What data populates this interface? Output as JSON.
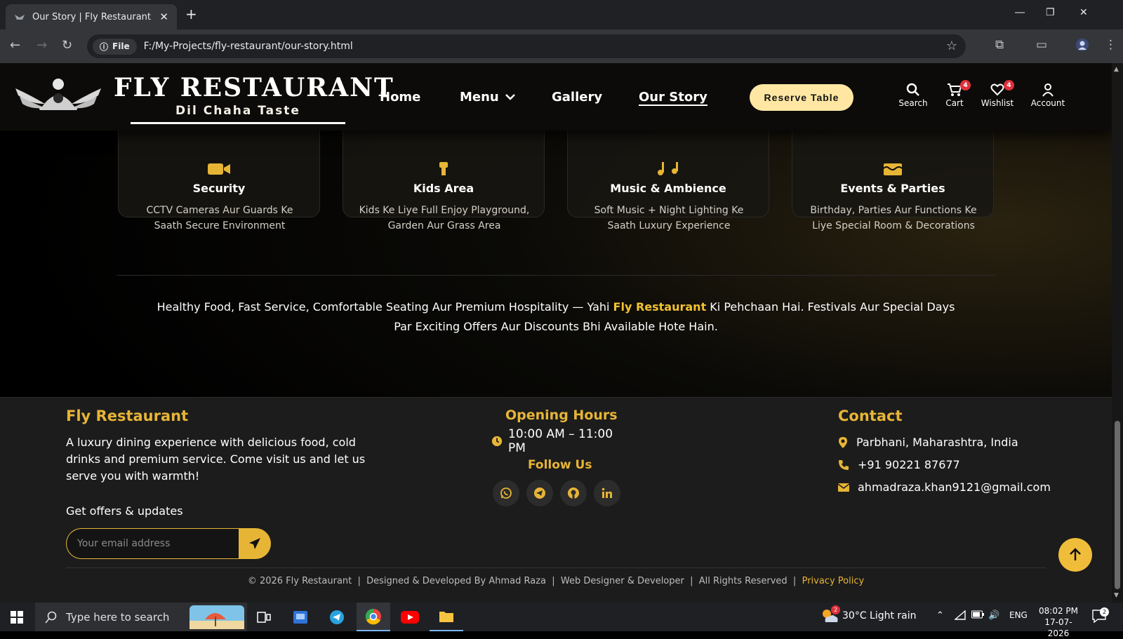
{
  "browser": {
    "tab_title": "Our Story | Fly Restaurant",
    "url_chip": "File",
    "url": "F:/My-Projects/fly-restaurant/our-story.html"
  },
  "header": {
    "brand": "FLY RESTAURANT",
    "tagline": "Dil Chaha Taste",
    "nav": {
      "home": "Home",
      "menu": "Menu",
      "gallery": "Gallery",
      "our_story": "Our Story"
    },
    "reserve": "Reserve Table",
    "actions": {
      "search": "Search",
      "cart": "Cart",
      "cart_count": "4",
      "wishlist": "Wishlist",
      "wishlist_count": "4",
      "account": "Account"
    }
  },
  "features": [
    {
      "title": "Security",
      "desc": "CCTV Cameras Aur Guards Ke Saath Secure Environment",
      "icon": "video-camera-icon"
    },
    {
      "title": "Kids Area",
      "desc": "Kids Ke Liye Full Enjoy Playground, Garden Aur Grass Area",
      "icon": "child-icon"
    },
    {
      "title": "Music & Ambience",
      "desc": "Soft Music + Night Lighting Ke Saath Luxury Experience",
      "icon": "music-icon"
    },
    {
      "title": "Events & Parties",
      "desc": "Birthday, Parties Aur Functions Ke Liye Special Room & Decorations",
      "icon": "cake-icon"
    }
  ],
  "about": {
    "before": "Healthy Food, Fast Service, Comfortable Seating Aur Premium Hospitality — Yahi ",
    "highlight": "Fly Restaurant",
    "after": " Ki Pehchaan Hai. Festivals Aur Special Days Par Exciting Offers Aur Discounts Bhi Available Hote Hain."
  },
  "footer": {
    "brand": "Fly Restaurant",
    "desc": "A luxury dining experience with delicious food, cold drinks and premium service. Come visit us and let us serve you with warmth!",
    "offers_label": "Get offers & updates",
    "email_placeholder": "Your email address",
    "hours_title": "Opening Hours",
    "hours": "10:00 AM – 11:00 PM",
    "follow_title": "Follow Us",
    "contact_title": "Contact",
    "address": "Parbhani, Maharashtra, India",
    "phone": "+91 90221 87677",
    "email": "ahmadraza.khan9121@gmail.com",
    "copyright": "© 2026 Fly Restaurant  |  Designed & Developed By Ahmad Raza  |  Web Designer & Developer  |  All Rights Reserved  |  ",
    "privacy": "Privacy Policy"
  },
  "taskbar": {
    "search_placeholder": "Type here to search",
    "weather": "30°C  Light rain",
    "weather_alerts": "2",
    "lang": "ENG",
    "time": "08:02 PM",
    "date": "17-07-2026",
    "notifications": "2"
  },
  "colors": {
    "accent": "#e7b536",
    "reserve_bg": "#ffe7a3",
    "badge": "#e0303a",
    "footer_bg": "#1c1c1c"
  }
}
